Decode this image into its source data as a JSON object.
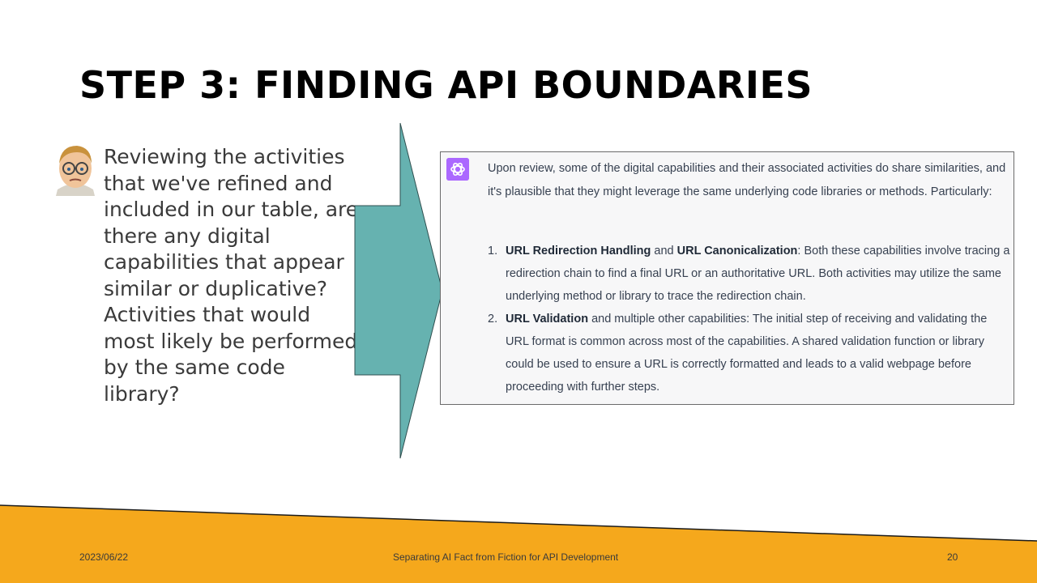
{
  "slide": {
    "title": "STEP 3: FINDING API BOUNDARIES",
    "prompt": "Reviewing the activities that we've refined and included in our table, are there any digital capabilities that appear similar or duplicative? Activities that would most likely be performed by the same code library?"
  },
  "response": {
    "intro": "Upon review, some of the digital capabilities and their associated activities do share similarities, and it's plausible that they might leverage the same underlying code libraries or methods. Particularly:",
    "items": [
      {
        "number": "1.",
        "term_a": "URL Redirection Handling",
        "joiner": " and ",
        "term_b": "URL Canonicalization",
        "text": ": Both these capabilities involve tracing a redirection chain to find a final URL or an authoritative URL. Both activities may utilize the same underlying method or library to trace the redirection chain."
      },
      {
        "number": "2.",
        "term_a": "URL Validation",
        "text": " and multiple other capabilities: The initial step of receiving and validating the URL format is common across most of the capabilities. A shared validation function or library could be used to ensure a URL is correctly formatted and leads to a valid webpage before proceeding with further steps."
      }
    ]
  },
  "footer": {
    "date": "2023/06/22",
    "title": "Separating AI Fact from Fiction for API Development",
    "page": "20"
  },
  "colors": {
    "arrow_fill": "#66b2b0",
    "footer_band": "#f5a81c",
    "ai_logo": "#ab68ff"
  }
}
